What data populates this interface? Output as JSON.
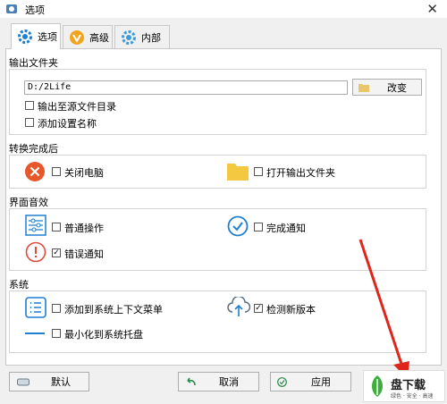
{
  "window": {
    "title": "选项",
    "close_glyph": "✕"
  },
  "tabs": [
    {
      "label": "选项",
      "icon": "gear-icon",
      "active": true
    },
    {
      "label": "高级",
      "icon": "badge-v-icon",
      "active": false
    },
    {
      "label": "内部",
      "icon": "gear-icon",
      "active": false
    }
  ],
  "output": {
    "title": "输出文件夹",
    "path_value": "D:/2Life",
    "change_button": "改变",
    "to_source": {
      "label": "输出至源文件目录",
      "checked": false
    },
    "add_name": {
      "label": "添加设置名称",
      "checked": false
    }
  },
  "after": {
    "title": "转换完成后",
    "shutdown": {
      "label": "关闭电脑",
      "checked": false
    },
    "open_folder": {
      "label": "打开输出文件夹",
      "checked": false
    }
  },
  "sound": {
    "title": "界面音效",
    "normal": {
      "label": "普通操作",
      "checked": false
    },
    "done": {
      "label": "完成通知",
      "checked": false
    },
    "error": {
      "label": "错误通知",
      "checked": true
    }
  },
  "system": {
    "title": "系统",
    "context_menu": {
      "label": "添加到系统上下文菜单",
      "checked": false
    },
    "check_update": {
      "label": "检测新版本",
      "checked": true
    },
    "tray": {
      "label": "最小化到系统托盘",
      "checked": false
    }
  },
  "footer": {
    "default_button": "默认",
    "cancel_button": "取消",
    "apply_button": "应用"
  },
  "watermark": {
    "text": "盘下载",
    "sub": "绿色 · 安全 · 高速"
  },
  "colors": {
    "accent": "#1e7fd2",
    "shutdown": "#e8572a",
    "error": "#e04a3a",
    "arrow": "#e0261a",
    "folder": "#f5c842"
  }
}
